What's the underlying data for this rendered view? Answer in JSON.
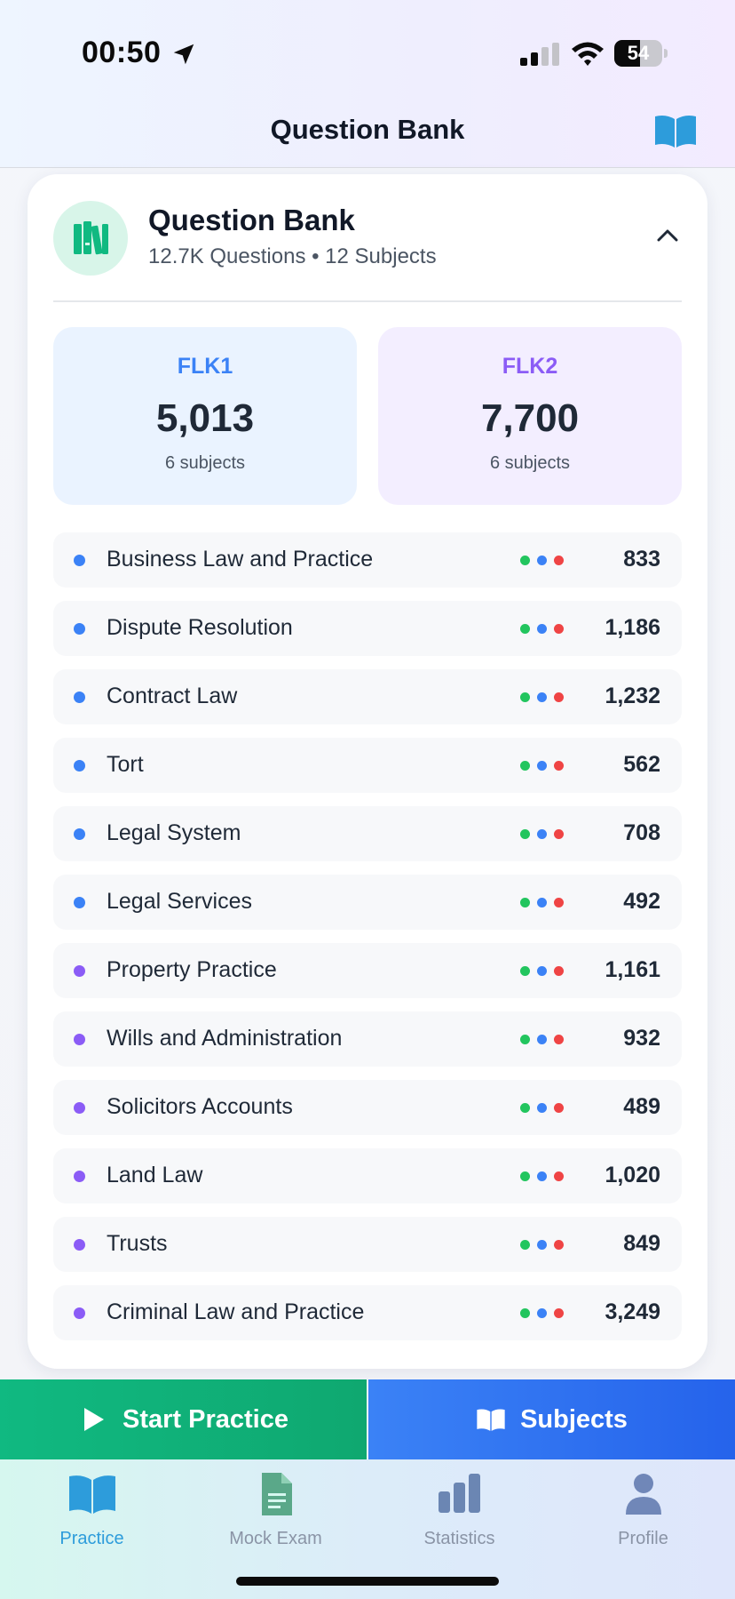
{
  "status_bar": {
    "time": "00:50",
    "battery_level": "54",
    "battery_fraction": 0.54
  },
  "nav": {
    "title": "Question Bank",
    "right_icon": "book-open-icon"
  },
  "card": {
    "title": "Question Bank",
    "subtitle": "12.7K Questions • 12 Subjects",
    "icon": "books-icon",
    "collapse_icon": "chevron-up-icon"
  },
  "exams": [
    {
      "label": "FLK1",
      "count": "5,013",
      "subjects": "6 subjects",
      "color": "#3b82f6"
    },
    {
      "label": "FLK2",
      "count": "7,700",
      "subjects": "6 subjects",
      "color": "#8b5cf6"
    }
  ],
  "subjects": [
    {
      "name": "Business Law and Practice",
      "count": "833",
      "group": "FLK1",
      "color": "#3b82f6"
    },
    {
      "name": "Dispute Resolution",
      "count": "1,186",
      "group": "FLK1",
      "color": "#3b82f6"
    },
    {
      "name": "Contract Law",
      "count": "1,232",
      "group": "FLK1",
      "color": "#3b82f6"
    },
    {
      "name": "Tort",
      "count": "562",
      "group": "FLK1",
      "color": "#3b82f6"
    },
    {
      "name": "Legal System",
      "count": "708",
      "group": "FLK1",
      "color": "#3b82f6"
    },
    {
      "name": "Legal Services",
      "count": "492",
      "group": "FLK1",
      "color": "#3b82f6"
    },
    {
      "name": "Property Practice",
      "count": "1,161",
      "group": "FLK2",
      "color": "#8b5cf6"
    },
    {
      "name": "Wills and Administration",
      "count": "932",
      "group": "FLK2",
      "color": "#8b5cf6"
    },
    {
      "name": "Solicitors Accounts",
      "count": "489",
      "group": "FLK2",
      "color": "#8b5cf6"
    },
    {
      "name": "Land Law",
      "count": "1,020",
      "group": "FLK2",
      "color": "#8b5cf6"
    },
    {
      "name": "Trusts",
      "count": "849",
      "group": "FLK2",
      "color": "#8b5cf6"
    },
    {
      "name": "Criminal Law and Practice",
      "count": "3,249",
      "group": "FLK2",
      "color": "#8b5cf6"
    }
  ],
  "difficulty_colors": [
    "#22c55e",
    "#3b82f6",
    "#ef4444"
  ],
  "actions": {
    "start_label": "Start Practice",
    "start_icon": "play-icon",
    "subjects_label": "Subjects",
    "subjects_icon": "book-open-icon"
  },
  "tabs": [
    {
      "label": "Practice",
      "icon": "book-open-icon",
      "active": true
    },
    {
      "label": "Mock Exam",
      "icon": "document-icon",
      "active": false
    },
    {
      "label": "Statistics",
      "icon": "bar-chart-icon",
      "active": false
    },
    {
      "label": "Profile",
      "icon": "person-icon",
      "active": false
    }
  ]
}
